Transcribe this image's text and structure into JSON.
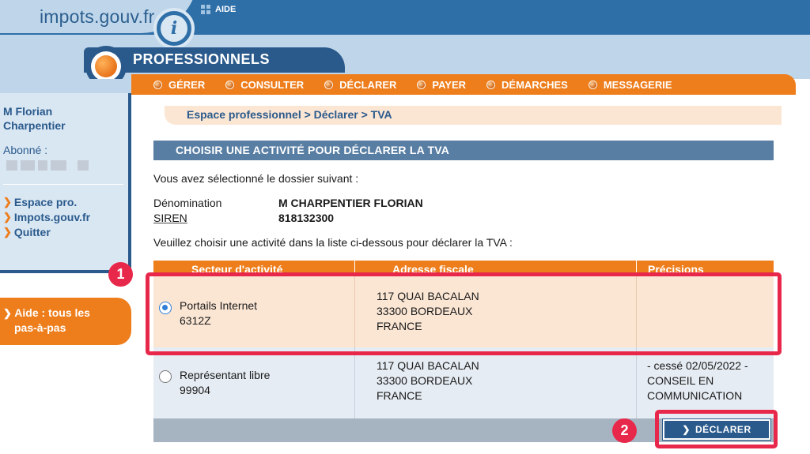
{
  "header": {
    "logo_text": "impots.gouv.fr",
    "logo_letter": "i",
    "aide_label": "AIDE",
    "section_title": "PROFESSIONNELS"
  },
  "menu": [
    {
      "label": "GÉRER"
    },
    {
      "label": "CONSULTER"
    },
    {
      "label": "DÉCLARER"
    },
    {
      "label": "PAYER"
    },
    {
      "label": "DÉMARCHES"
    },
    {
      "label": "MESSAGERIE"
    }
  ],
  "sidebar": {
    "user_line1": "M  Florian",
    "user_line2": "Charpentier",
    "abonne_label": "Abonné :",
    "links": [
      {
        "label": "Espace pro."
      },
      {
        "label": "Impots.gouv.fr"
      },
      {
        "label": "Quitter"
      }
    ],
    "aide_line1": "Aide : tous les",
    "aide_line2": "pas-à-pas"
  },
  "main": {
    "breadcrumb": "Espace professionnel > Déclarer > TVA",
    "title": "CHOISIR UNE ACTIVITÉ POUR DÉCLARER LA TVA",
    "intro": "Vous avez sélectionné le dossier suivant :",
    "denomination_label": "Dénomination",
    "denomination_value": "M CHARPENTIER FLORIAN",
    "siren_label": "SIREN",
    "siren_value": "818132300",
    "instruction": "Veuillez choisir une activité dans la liste ci-dessous pour déclarer la TVA :"
  },
  "table": {
    "headers": [
      "Secteur d'activité",
      "Adresse fiscale",
      "Précisions"
    ],
    "rows": [
      {
        "selected": true,
        "activity": "Portails Internet",
        "code": "6312Z",
        "address": [
          "117 QUAI BACALAN",
          "33300 BORDEAUX",
          "FRANCE"
        ],
        "precisions": [
          "",
          "",
          ""
        ]
      },
      {
        "selected": false,
        "activity": "Représentant libre",
        "code": "99904",
        "address": [
          "117 QUAI BACALAN",
          "33300 BORDEAUX",
          "FRANCE"
        ],
        "precisions": [
          "- cessé 02/05/2022 -",
          "CONSEIL EN",
          "COMMUNICATION"
        ]
      }
    ]
  },
  "actions": {
    "declarer_label": "DÉCLARER"
  },
  "annotations": {
    "badge1": "1",
    "badge2": "2"
  },
  "colors": {
    "brand_blue": "#2a5a8c",
    "accent_orange": "#ee7d1b",
    "highlight_red": "#e8284a",
    "selected_row": "#fbe6d4"
  }
}
